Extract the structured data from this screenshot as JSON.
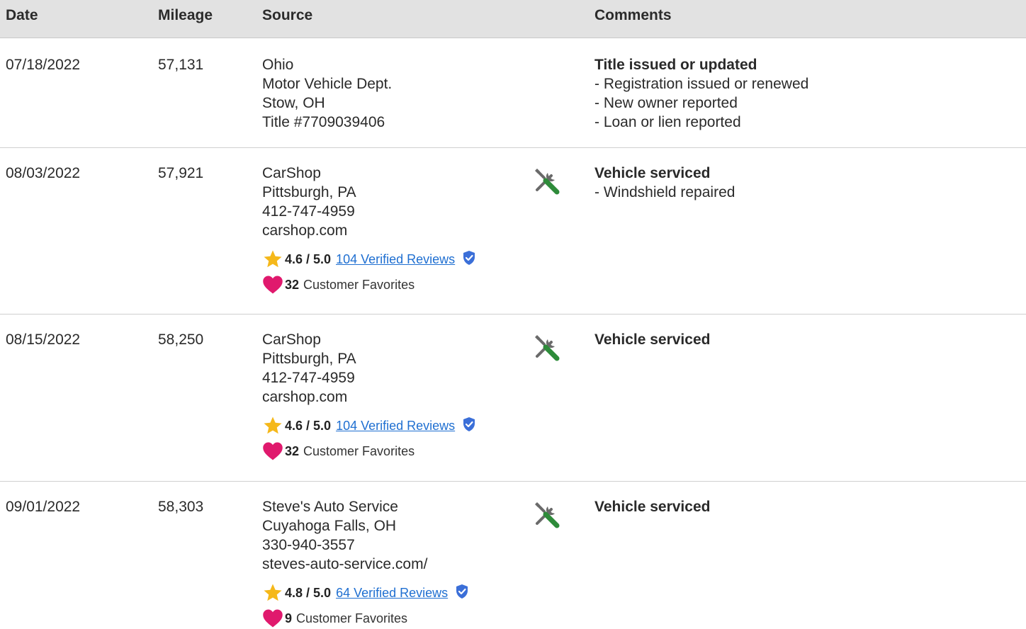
{
  "header": {
    "date": "Date",
    "mileage": "Mileage",
    "source": "Source",
    "comments": "Comments"
  },
  "colors": {
    "star": "#f5b81a",
    "heart": "#e0196d",
    "verified": "#3b6fd8",
    "link": "#1f6fd1",
    "wrench_green": "#2e8b3a",
    "tool_gray": "#6a6a6a"
  },
  "rows": [
    {
      "date": "07/18/2022",
      "mileage": "57,131",
      "source": [
        "Ohio",
        "Motor Vehicle Dept.",
        "Stow, OH",
        "Title #7709039406"
      ],
      "comment_title": "Title issued or updated",
      "comment_items": [
        "- Registration issued or renewed",
        "- New owner reported",
        "- Loan or lien reported"
      ]
    },
    {
      "date": "08/03/2022",
      "mileage": "57,921",
      "source": [
        "CarShop",
        "Pittsburgh, PA",
        "412-747-4959",
        "carshop.com"
      ],
      "rating": "4.6 / 5.0",
      "reviews": "104 Verified Reviews",
      "favorites_count": "32",
      "favorites_label": "Customer Favorites",
      "comment_title": "Vehicle serviced",
      "comment_items": [
        "- Windshield repaired"
      ]
    },
    {
      "date": "08/15/2022",
      "mileage": "58,250",
      "source": [
        "CarShop",
        "Pittsburgh, PA",
        "412-747-4959",
        "carshop.com"
      ],
      "rating": "4.6 / 5.0",
      "reviews": "104 Verified Reviews",
      "favorites_count": "32",
      "favorites_label": "Customer Favorites",
      "comment_title": "Vehicle serviced",
      "comment_items": []
    },
    {
      "date": "09/01/2022",
      "mileage": "58,303",
      "source": [
        "Steve's Auto Service",
        "Cuyahoga Falls, OH",
        "330-940-3557",
        "steves-auto-service.com/"
      ],
      "rating": "4.8 / 5.0",
      "reviews": "64 Verified Reviews",
      "favorites_count": "9",
      "favorites_label": "Customer Favorites",
      "comment_title": "Vehicle serviced",
      "comment_items": []
    }
  ]
}
